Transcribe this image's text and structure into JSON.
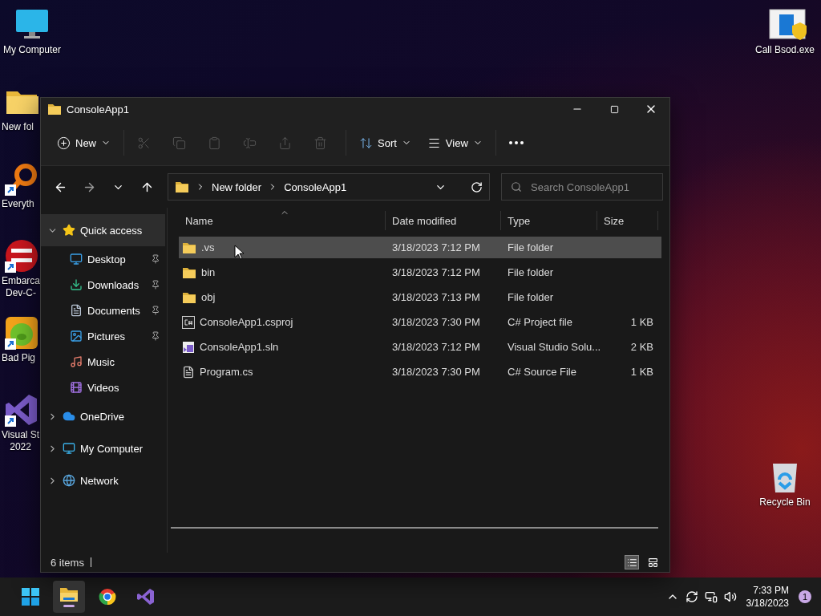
{
  "desktop": {
    "left_icons": [
      {
        "lines": [
          "My Computer"
        ],
        "kind": "monitor",
        "shortcut": false
      },
      {
        "lines": [
          "New fol"
        ],
        "kind": "folder",
        "shortcut": false
      },
      {
        "lines": [
          "Everyth"
        ],
        "kind": "search",
        "shortcut": true
      },
      {
        "lines": [
          "Embarca",
          "Dev-C-"
        ],
        "kind": "devcpp",
        "shortcut": true
      },
      {
        "lines": [
          "Bad Pig"
        ],
        "kind": "game",
        "shortcut": true
      },
      {
        "lines": [
          "Visual St",
          "2022"
        ],
        "kind": "vs",
        "shortcut": true
      }
    ],
    "right_icons": [
      {
        "lines": [
          "Call Bsod.exe"
        ],
        "kind": "installer",
        "shortcut": false
      },
      {
        "lines": [
          "Recycle Bin"
        ],
        "kind": "recycle",
        "shortcut": false
      }
    ]
  },
  "window": {
    "title": "ConsoleApp1",
    "toolbar": {
      "new_label": "New",
      "actions": [
        {
          "kind": "cut",
          "disabled": true
        },
        {
          "kind": "copy",
          "disabled": true
        },
        {
          "kind": "paste",
          "disabled": true
        },
        {
          "kind": "rename",
          "disabled": true
        },
        {
          "kind": "share",
          "disabled": true
        },
        {
          "kind": "delete",
          "disabled": true
        }
      ],
      "sort_label": "Sort",
      "view_label": "View"
    },
    "address": {
      "breadcrumbs": [
        "New folder",
        "ConsoleApp1"
      ]
    },
    "search": {
      "placeholder": "Search ConsoleApp1"
    },
    "nav": [
      {
        "label": "Quick access",
        "kind": "star",
        "expanded": true,
        "selected": true,
        "children": [
          {
            "label": "Desktop",
            "kind": "desktop",
            "pinned": true
          },
          {
            "label": "Downloads",
            "kind": "downloads",
            "pinned": true
          },
          {
            "label": "Documents",
            "kind": "documents",
            "pinned": true
          },
          {
            "label": "Pictures",
            "kind": "pictures",
            "pinned": true
          },
          {
            "label": "Music",
            "kind": "music",
            "pinned": false
          },
          {
            "label": "Videos",
            "kind": "videos",
            "pinned": false
          }
        ]
      },
      {
        "label": "OneDrive",
        "kind": "cloud",
        "expanded": false,
        "selected": false
      },
      {
        "label": "My Computer",
        "kind": "computer",
        "expanded": false,
        "selected": false
      },
      {
        "label": "Network",
        "kind": "network",
        "expanded": false,
        "selected": false
      }
    ],
    "columns": [
      "Name",
      "Date modified",
      "Type",
      "Size"
    ],
    "rows": [
      {
        "name": ".vs",
        "date": "3/18/2023 7:12 PM",
        "type": "File folder",
        "size": "",
        "kind": "folder",
        "selected": true
      },
      {
        "name": "bin",
        "date": "3/18/2023 7:12 PM",
        "type": "File folder",
        "size": "",
        "kind": "folder",
        "selected": false
      },
      {
        "name": "obj",
        "date": "3/18/2023 7:13 PM",
        "type": "File folder",
        "size": "",
        "kind": "folder",
        "selected": false
      },
      {
        "name": "ConsoleApp1.csproj",
        "date": "3/18/2023 7:30 PM",
        "type": "C# Project file",
        "size": "1 KB",
        "kind": "csproj",
        "selected": false
      },
      {
        "name": "ConsoleApp1.sln",
        "date": "3/18/2023 7:12 PM",
        "type": "Visual Studio Solu...",
        "size": "2 KB",
        "kind": "sln",
        "selected": false
      },
      {
        "name": "Program.cs",
        "date": "3/18/2023 7:30 PM",
        "type": "C# Source File",
        "size": "1 KB",
        "kind": "cs",
        "selected": false
      }
    ],
    "status": "6 items",
    "view_modes": [
      {
        "kind": "details",
        "selected": true
      },
      {
        "kind": "tiles",
        "selected": false
      }
    ]
  },
  "taskbar": {
    "apps": [
      {
        "kind": "explorer",
        "selected": true
      },
      {
        "kind": "chrome",
        "selected": false
      },
      {
        "kind": "vs",
        "selected": false
      }
    ],
    "time": "7:33 PM",
    "date": "3/18/2023",
    "notifications": "1"
  }
}
